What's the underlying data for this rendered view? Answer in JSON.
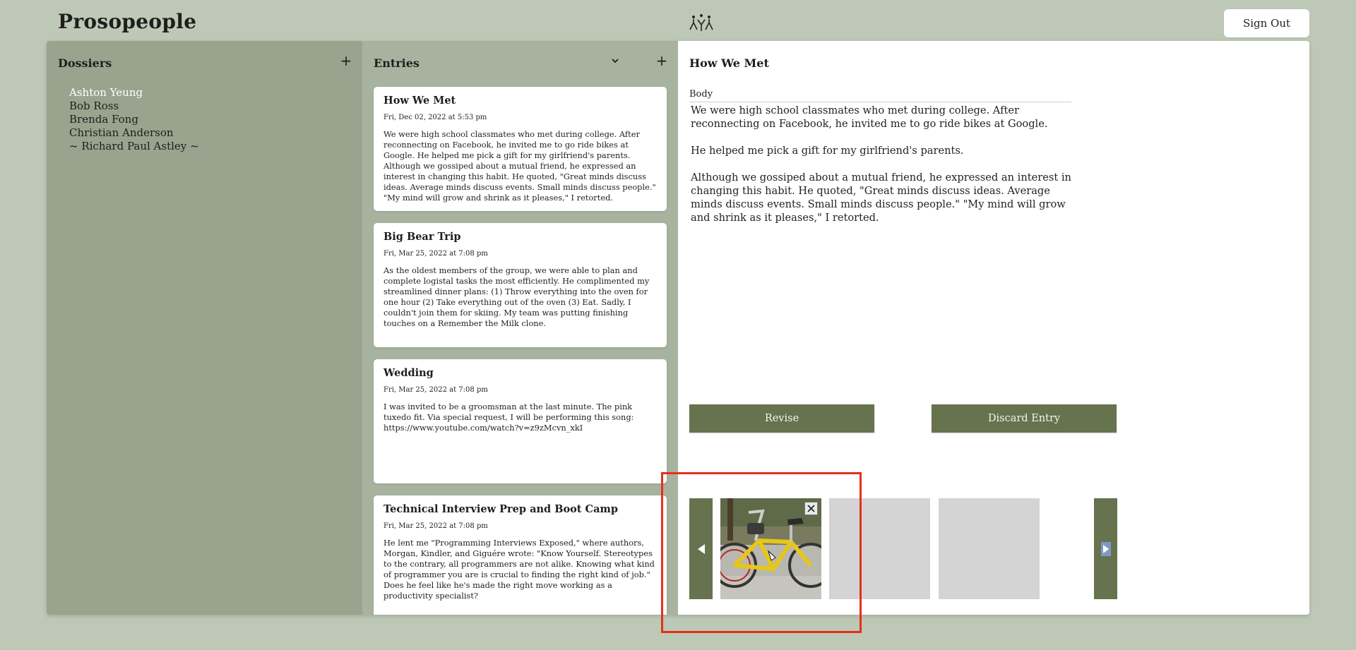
{
  "header": {
    "brand": "Prosopeople",
    "logo_icon": "figures-logo-icon",
    "sign_out_label": "Sign Out"
  },
  "dossiers": {
    "title": "Dossiers",
    "add_icon": "plus-icon",
    "items": [
      {
        "name": "Ashton Yeung",
        "active": true
      },
      {
        "name": "Bob Ross",
        "active": false
      },
      {
        "name": "Brenda Fong",
        "active": false
      },
      {
        "name": "Christian Anderson",
        "active": false
      },
      {
        "name": "~ Richard Paul Astley ~",
        "active": false
      }
    ]
  },
  "entries": {
    "title": "Entries",
    "sort_icon": "chevron-down-icon",
    "add_icon": "plus-icon",
    "items": [
      {
        "title": "How We Met",
        "date": "Fri, Dec 02, 2022 at 5:53 pm",
        "body": "We were high school classmates who met during college. After reconnecting on Facebook, he invited me to go ride bikes at Google. He helped me pick a gift for my girlfriend's parents. Although we gossiped about a mutual friend, he expressed an interest in changing this habit. He quoted, \"Great minds discuss ideas. Average minds discuss events. Small minds discuss people.\" \"My mind will grow and shrink as it pleases,\" I retorted."
      },
      {
        "title": "Big Bear Trip",
        "date": "Fri, Mar 25, 2022 at 7:08 pm",
        "body": "As the oldest members of the group, we were able to plan and complete logistal tasks the most efficiently. He complimented my streamlined dinner plans: (1) Throw everything into the oven for one hour (2) Take everything out of the oven (3) Eat. Sadly, I couldn't join them for skiing. My team was putting finishing touches on a Remember the Milk clone."
      },
      {
        "title": "Wedding",
        "date": "Fri, Mar 25, 2022 at 7:08 pm",
        "body": "I was invited to be a groomsman at the last minute. The pink tuxedo fit. Via special request, I will be performing this song: https://www.youtube.com/watch?v=z9zMcvn_xkI"
      },
      {
        "title": "Technical Interview Prep and Boot Camp",
        "date": "Fri, Mar 25, 2022 at 7:08 pm",
        "body": "He lent me \"Programming Interviews Exposed,\" where authors, Morgan, Kindler, and Giguére wrote: \"Know Yourself. Stereotypes to the contrary, all programmers are not alike. Knowing what kind of programmer you are is crucial to finding the right kind of job.\" Does he feel like he's made the right move working as a productivity specialist?"
      }
    ]
  },
  "detail": {
    "title": "How We Met",
    "body_label": "Body",
    "paragraphs": [
      "We were high school classmates who met during college. After reconnecting on Facebook, he invited me to go ride bikes at Google.",
      "He helped me pick a gift for my girlfriend's parents.",
      "Although we gossiped about a mutual friend, he expressed an interest in changing this habit. He quoted, \"Great minds discuss ideas. Average minds discuss events. Small minds discuss people.\" \"My mind will grow and shrink as it pleases,\" I retorted."
    ],
    "revise_label": "Revise",
    "discard_label": "Discard Entry"
  },
  "gallery": {
    "prev_icon": "triangle-left-icon",
    "next_icon": "triangle-right-icon",
    "close_icon": "close-icon",
    "photo_icon": "bicycle-photo",
    "empty_slots": 2
  },
  "colors": {
    "background": "#bec8b6",
    "dossier_panel": "#98a48e",
    "entries_panel": "#a8b39f",
    "accent": "#66734e",
    "highlight": "#e5301a"
  }
}
